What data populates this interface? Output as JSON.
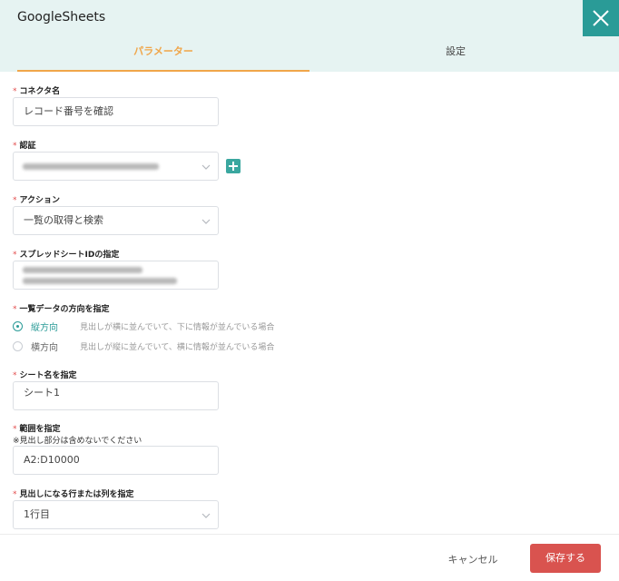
{
  "app": {
    "title": "GoogleSheets"
  },
  "tabs": {
    "params": "パラメーター",
    "settings": "設定"
  },
  "form": {
    "required_mark": "*",
    "connector": {
      "label": "コネクタ名",
      "value": "レコード番号を確認"
    },
    "auth": {
      "label": "認証"
    },
    "action": {
      "label": "アクション",
      "value": "一覧の取得と検索"
    },
    "spreadsheet": {
      "label": "スプレッドシートIDの指定"
    },
    "direction": {
      "label": "一覧データの方向を指定",
      "options": [
        {
          "label": "縦方向",
          "desc": "見出しが横に並んでいて、下に情報が並んでいる場合",
          "selected": true
        },
        {
          "label": "横方向",
          "desc": "見出しが縦に並んでいて、横に情報が並んでいる場合",
          "selected": false
        }
      ]
    },
    "sheet": {
      "label": "シート名を指定",
      "value": "シート1"
    },
    "range": {
      "label": "範囲を指定",
      "note": "※見出し部分は含めないでください",
      "value": "A2:D10000"
    },
    "header_row": {
      "label": "見出しになる行または列を指定",
      "value": "1行目"
    }
  },
  "footer": {
    "cancel": "キャンセル",
    "save": "保存する"
  },
  "colors": {
    "accent": "#2a9b97",
    "tab_active": "#f0a64a",
    "save": "#d9534f",
    "required": "#e34c4c"
  }
}
